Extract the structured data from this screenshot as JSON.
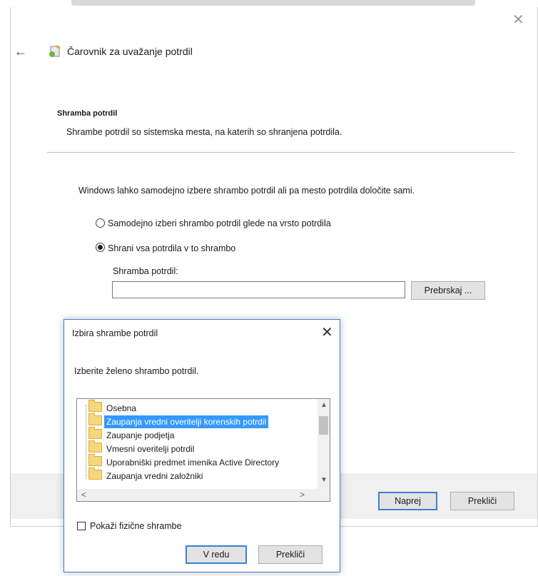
{
  "wizard": {
    "title": "Čarovnik za uvažanje potrdil",
    "section_title": "Shramba potrdil",
    "section_description": "Shrambe potrdil so sistemska mesta, na katerih so shranjena potrdila.",
    "intro": "Windows lahko samodejno izbere shrambo potrdil ali pa mesto potrdila določite sami.",
    "options": [
      {
        "label": "Samodejno izberi shrambo potrdil glede na vrsto potrdila",
        "selected": false
      },
      {
        "label": "Shrani vsa potrdila v to shrambo",
        "selected": true
      }
    ],
    "store_label": "Shramba potrdil:",
    "store_value": "",
    "browse_label": "Prebrskaj ...",
    "next_label": "Naprej",
    "cancel_label": "Prekliči"
  },
  "dialog": {
    "title": "Izbira shrambe potrdil",
    "prompt": "Izberite želeno shrambo potrdil.",
    "stores": [
      "Osebna",
      "Zaupanja vredni overitelji korenskih potrdil",
      "Zaupanje podjetja",
      "Vmesni overitelji potrdil",
      "Uporabniški predmet imenika Active Directory",
      "Zaupanja vredni založniki"
    ],
    "selected_index": 1,
    "show_physical_label": "Pokaži fizične shrambe",
    "show_physical_checked": false,
    "ok_label": "V redu",
    "cancel_label": "Prekliči"
  },
  "colors": {
    "accent": "#3c7fd6",
    "selection": "#3399ff",
    "button_face": "#e3e3e3"
  }
}
